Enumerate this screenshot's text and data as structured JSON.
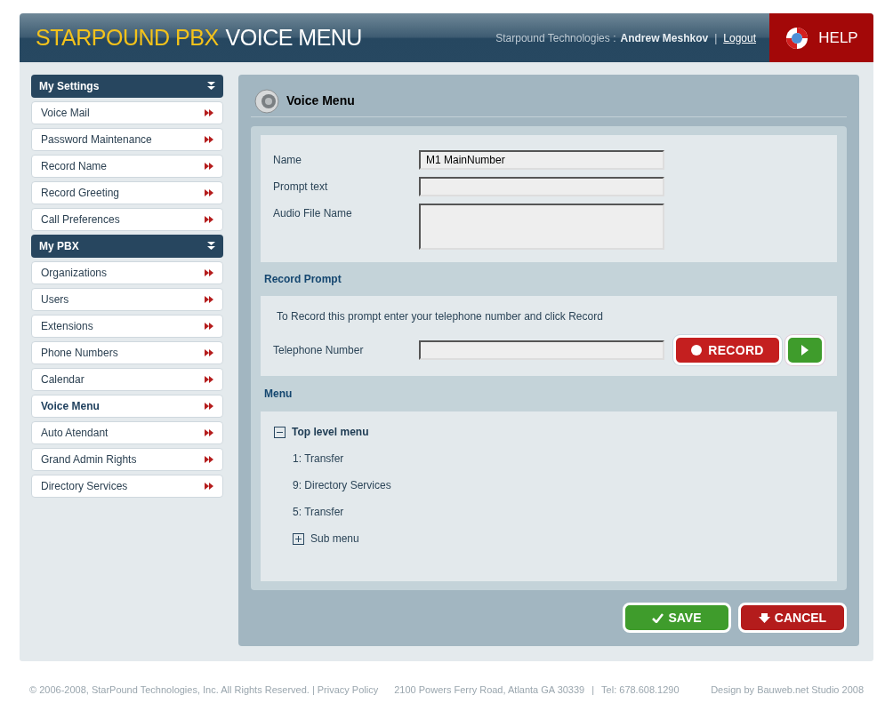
{
  "header": {
    "brand": "STARPOUND PBX",
    "page": "VOICE MENU",
    "company": "Starpound Technologies :",
    "user": "Andrew Meshkov",
    "separator": "|",
    "logout": "Logout",
    "help": "HELP"
  },
  "sidebar": {
    "sections": [
      {
        "title": "My Settings",
        "items": [
          {
            "label": "Voice Mail",
            "selected": false
          },
          {
            "label": "Password Maintenance",
            "selected": false
          },
          {
            "label": "Record Name",
            "selected": false
          },
          {
            "label": "Record Greeting",
            "selected": false
          },
          {
            "label": "Call Preferences",
            "selected": false
          }
        ]
      },
      {
        "title": "My PBX",
        "items": [
          {
            "label": "Organizations",
            "selected": false
          },
          {
            "label": "Users",
            "selected": false
          },
          {
            "label": "Extensions",
            "selected": false
          },
          {
            "label": "Phone Numbers",
            "selected": false
          },
          {
            "label": "Calendar",
            "selected": false
          },
          {
            "label": "Voice Menu",
            "selected": true
          },
          {
            "label": "Auto Atendant",
            "selected": false
          },
          {
            "label": "Grand Admin Rights",
            "selected": false
          },
          {
            "label": "Directory Services",
            "selected": false
          }
        ]
      }
    ]
  },
  "panel": {
    "title": "Voice Menu",
    "fields": [
      {
        "label": "Name",
        "value": "M1 MainNumber",
        "kind": "input"
      },
      {
        "label": "Prompt text",
        "kind": "input"
      },
      {
        "label": "Audio File Name",
        "kind": "textarea"
      }
    ],
    "record": {
      "heading": "Record Prompt",
      "hint": "To Record this prompt enter your telephone number and click Record",
      "phone_label": "Telephone Number",
      "record_button": "RECORD"
    },
    "menu": {
      "heading": "Menu",
      "tree": [
        {
          "label": "Top level menu",
          "kind": "branch",
          "expanded": true,
          "children": [
            {
              "label": "1: Transfer",
              "kind": "leaf"
            },
            {
              "label": "9: Directory Services",
              "kind": "leaf"
            },
            {
              "label": "5: Transfer",
              "kind": "leaf"
            },
            {
              "label": "Sub menu",
              "kind": "branch",
              "expanded": false
            }
          ]
        }
      ]
    },
    "buttons": [
      {
        "label": "SAVE",
        "kind": "save"
      },
      {
        "label": "CANCEL",
        "kind": "cancel"
      }
    ]
  },
  "footer": {
    "copyright": "© 2006-2008, StarPound Technologies, Inc. All Rights Reserved.",
    "sep1": "|",
    "privacy": "Privacy Policy",
    "address": "2100 Powers Ferry Road, Atlanta GA 30339",
    "sep2": "|",
    "tel": "Tel: 678.608.1290",
    "credit": "Design by Bauweb.net Studio 2008"
  }
}
